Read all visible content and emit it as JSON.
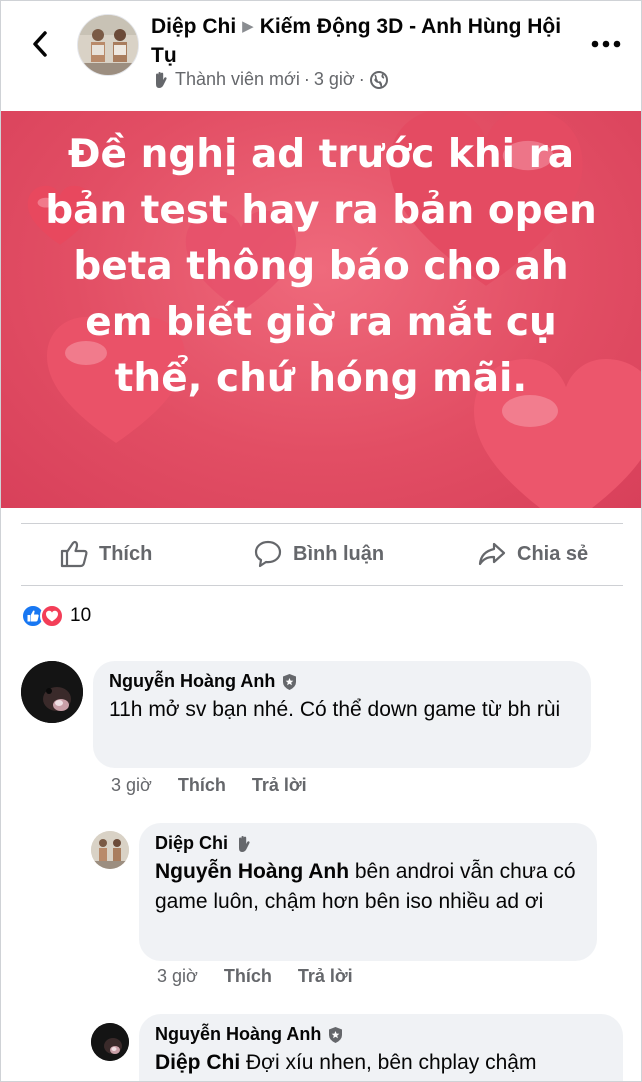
{
  "header": {
    "author": "Diệp Chi",
    "group": "Kiếm Động 3D - Anh Hùng Hội Tụ",
    "badge": "Thành viên mới",
    "separator": "·",
    "time": "3 giờ",
    "privacy_icon": "globe-icon"
  },
  "post": {
    "text": "Đề nghị ad trước khi ra bản test hay ra bản open beta thông báo cho ah em biết giờ ra mắt cụ thể, chứ hóng mãi.",
    "background_color": "#e24e64"
  },
  "actions": {
    "like": "Thích",
    "comment": "Bình luận",
    "share": "Chia sẻ"
  },
  "reactions": {
    "count": "10",
    "like_color": "#1877f2",
    "love_color": "#f33e58"
  },
  "comments": [
    {
      "author": "Nguyễn Hoàng Anh",
      "text": "11h mở sv bạn nhé. Có thể down game từ bh rùi",
      "time": "3 giờ",
      "like": "Thích",
      "reply": "Trả lời"
    }
  ],
  "replies": [
    {
      "author": "Diệp Chi",
      "mention": "Nguyễn Hoàng Anh",
      "text": " bên androi vẫn chưa có game luôn, chậm hơn bên iso nhiều ad ơi",
      "time": "3 giờ",
      "like": "Thích",
      "reply": "Trả lời"
    },
    {
      "author": "Nguyễn Hoàng Anh",
      "mention": "Diệp Chi",
      "text": " Đợi xíu nhen, bên chplay chậm"
    }
  ]
}
